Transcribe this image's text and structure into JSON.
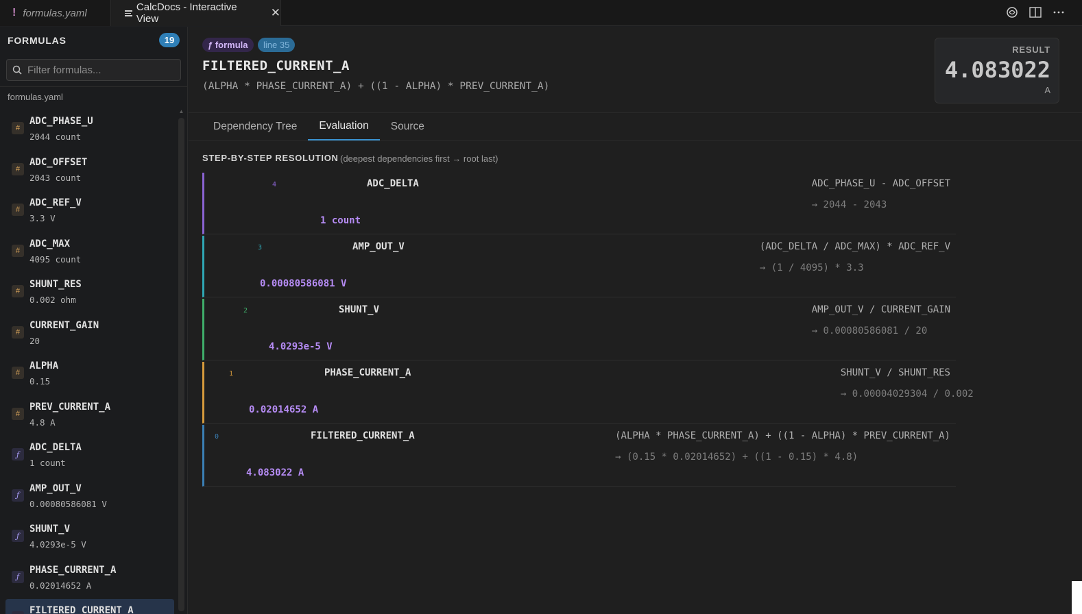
{
  "tabs_bar": {
    "file_tab": {
      "marker": "!",
      "label": "formulas.yaml"
    },
    "view_tab": {
      "label": "CalcDocs - Interactive View",
      "close": "✕"
    }
  },
  "sidebar": {
    "title": "FORMULAS",
    "count": "19",
    "search_placeholder": "Filter formulas...",
    "file_label": "formulas.yaml",
    "items": [
      {
        "kind": "#",
        "name": "ADC_PHASE_U",
        "value": "2044 count"
      },
      {
        "kind": "#",
        "name": "ADC_OFFSET",
        "value": "2043 count"
      },
      {
        "kind": "#",
        "name": "ADC_REF_V",
        "value": "3.3 V"
      },
      {
        "kind": "#",
        "name": "ADC_MAX",
        "value": "4095 count"
      },
      {
        "kind": "#",
        "name": "SHUNT_RES",
        "value": "0.002 ohm"
      },
      {
        "kind": "#",
        "name": "CURRENT_GAIN",
        "value": "20"
      },
      {
        "kind": "#",
        "name": "ALPHA",
        "value": "0.15"
      },
      {
        "kind": "#",
        "name": "PREV_CURRENT_A",
        "value": "4.8 A"
      },
      {
        "kind": "ƒ",
        "name": "ADC_DELTA",
        "value": "1 count"
      },
      {
        "kind": "ƒ",
        "name": "AMP_OUT_V",
        "value": "0.00080586081 V"
      },
      {
        "kind": "ƒ",
        "name": "SHUNT_V",
        "value": "4.0293e-5 V"
      },
      {
        "kind": "ƒ",
        "name": "PHASE_CURRENT_A",
        "value": "0.02014652 A"
      },
      {
        "kind": "ƒ",
        "name": "FILTERED_CURRENT_A",
        "value": ""
      }
    ]
  },
  "header": {
    "badge_formula": "ƒ formula",
    "badge_line": "line 35",
    "title": "FILTERED_CURRENT_A",
    "expression": "(ALPHA * PHASE_CURRENT_A) + ((1 - ALPHA) * PREV_CURRENT_A)",
    "result_label": "RESULT",
    "result_value": "4.083022",
    "result_unit": "A"
  },
  "view_tabs": [
    "Dependency Tree",
    "Evaluation",
    "Source"
  ],
  "steps": {
    "title": "STEP-BY-STEP RESOLUTION",
    "subtitle": "(deepest dependencies first → root last)",
    "items": [
      {
        "depth": "4",
        "name": "ADC_DELTA",
        "expr": "ADC_PHASE_U - ADC_OFFSET",
        "subst": "→ 2044 - 2043",
        "result": "1 count",
        "color": "#8a63d2"
      },
      {
        "depth": "3",
        "name": "AMP_OUT_V",
        "expr": "(ADC_DELTA / ADC_MAX) * ADC_REF_V",
        "subst": "→ (1 / 4095) * 3.3",
        "result": "0.00080586081 V",
        "color": "#2fa7b4"
      },
      {
        "depth": "2",
        "name": "SHUNT_V",
        "expr": "AMP_OUT_V / CURRENT_GAIN",
        "subst": "→ 0.00080586081 / 20",
        "result": "4.0293e-5 V",
        "color": "#3fae6a"
      },
      {
        "depth": "1",
        "name": "PHASE_CURRENT_A",
        "expr": "SHUNT_V / SHUNT_RES",
        "subst": "→ 0.00004029304 / 0.002",
        "result": "0.02014652 A",
        "color": "#d69a3c"
      },
      {
        "depth": "0",
        "name": "FILTERED_CURRENT_A",
        "expr": "(ALPHA * PHASE_CURRENT_A) + ((1 - ALPHA) * PREV_CURRENT_A)",
        "subst": "→ (0.15 * 0.02014652) + ((1 - 0.15) * 4.8)",
        "result": "4.083022 A",
        "color": "#3a7fb5"
      }
    ]
  }
}
